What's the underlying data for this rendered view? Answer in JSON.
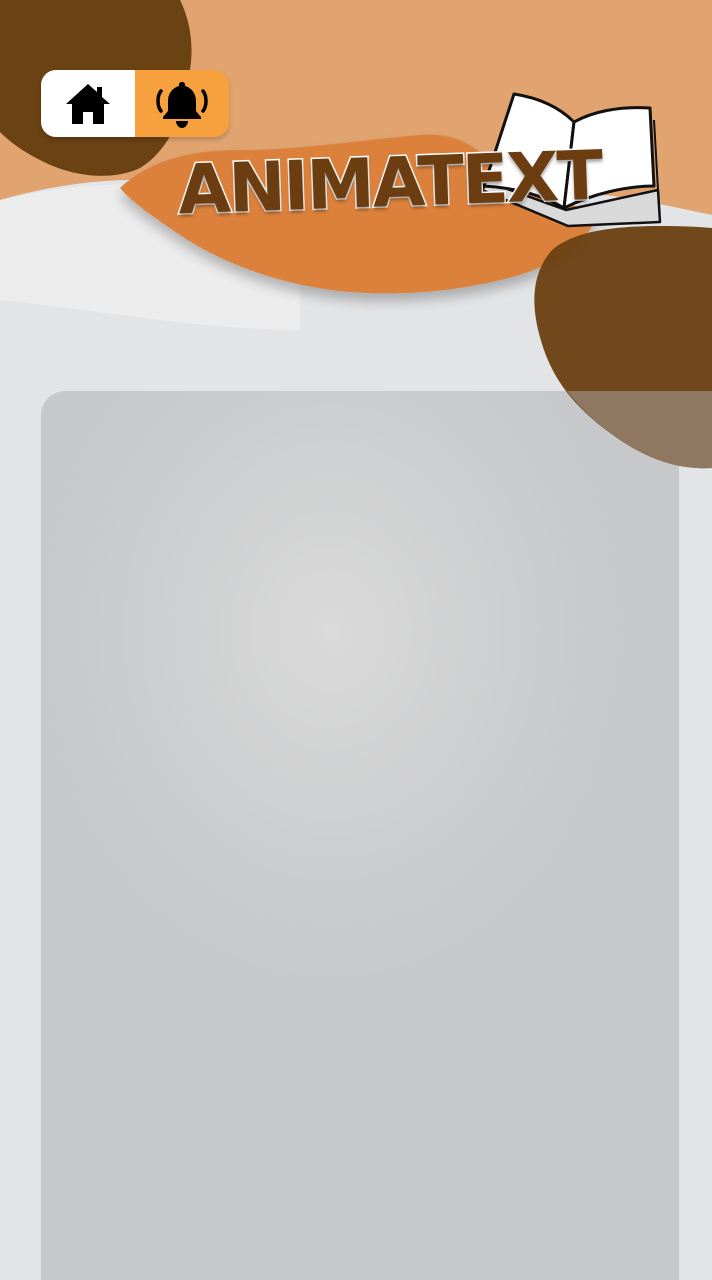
{
  "app": {
    "title": "ANIMATEXT"
  },
  "nav": {
    "home_icon": "home-icon",
    "notifications_icon": "bell-ringing-icon"
  },
  "colors": {
    "header_peach": "#e1a470",
    "header_orange": "#dc813a",
    "accent_orange": "#f6a13d",
    "brown": "#6b4213",
    "background_gray": "#e3e4e6",
    "panel_gray": "#c9cacc"
  }
}
